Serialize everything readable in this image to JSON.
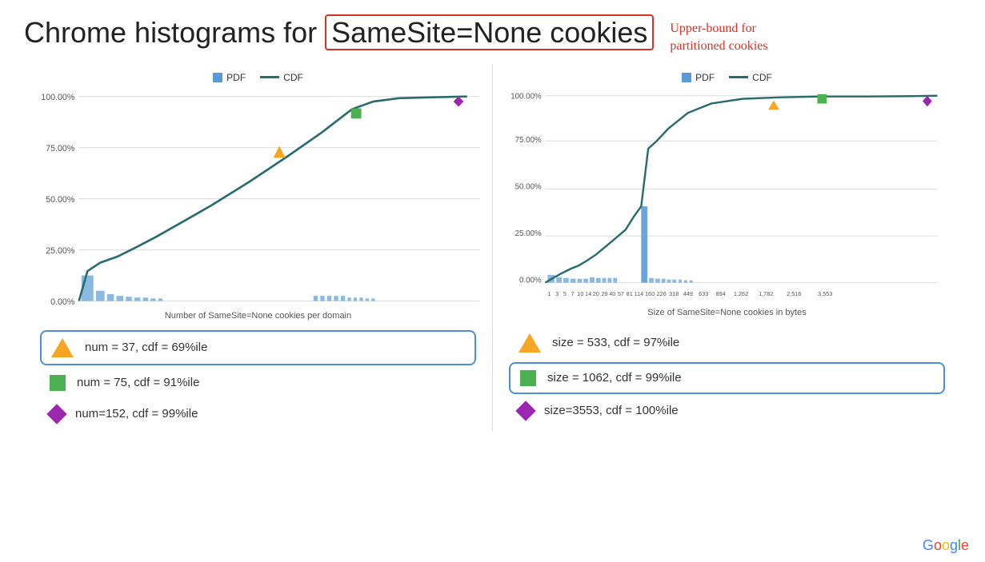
{
  "title": {
    "prefix": "Chrome histograms for ",
    "highlight": "SameSite=None cookies",
    "annotation_line1": "Upper-bound for",
    "annotation_line2": "partitioned cookies"
  },
  "chart_left": {
    "legend": {
      "pdf_label": "PDF",
      "cdf_label": "CDF"
    },
    "y_labels": [
      "100.00%",
      "75.00%",
      "50.00%",
      "25.00%",
      "0.00%"
    ],
    "chart_label": "Number of SameSite=None cookies per domain",
    "info_items": [
      {
        "id": "triangle",
        "text": "num = 37, cdf = 69%ile",
        "highlighted": true
      },
      {
        "id": "square",
        "text": "num = 75, cdf = 91%ile",
        "highlighted": false
      },
      {
        "id": "diamond",
        "text": "num=152, cdf = 99%ile",
        "highlighted": false
      }
    ]
  },
  "chart_right": {
    "legend": {
      "pdf_label": "PDF",
      "cdf_label": "CDF"
    },
    "y_labels": [
      "100.00%",
      "75.00%",
      "50.00%",
      "25.00%",
      "0.00%"
    ],
    "x_labels": [
      "1",
      "3",
      "5",
      "7",
      "10",
      "14",
      "20",
      "29",
      "40",
      "57",
      "81",
      "114",
      "160",
      "226",
      "318",
      "449",
      "633",
      "894",
      "1,262",
      "1,782",
      "2,516",
      "3,553"
    ],
    "chart_label": "Size of SameSite=None cookies in bytes",
    "info_items": [
      {
        "id": "triangle",
        "text": "size = 533, cdf = 97%ile",
        "highlighted": false
      },
      {
        "id": "square",
        "text": "size = 1062, cdf = 99%ile",
        "highlighted": true
      },
      {
        "id": "diamond",
        "text": "size=3553, cdf = 100%ile",
        "highlighted": false
      }
    ]
  },
  "google_logo": "Google"
}
